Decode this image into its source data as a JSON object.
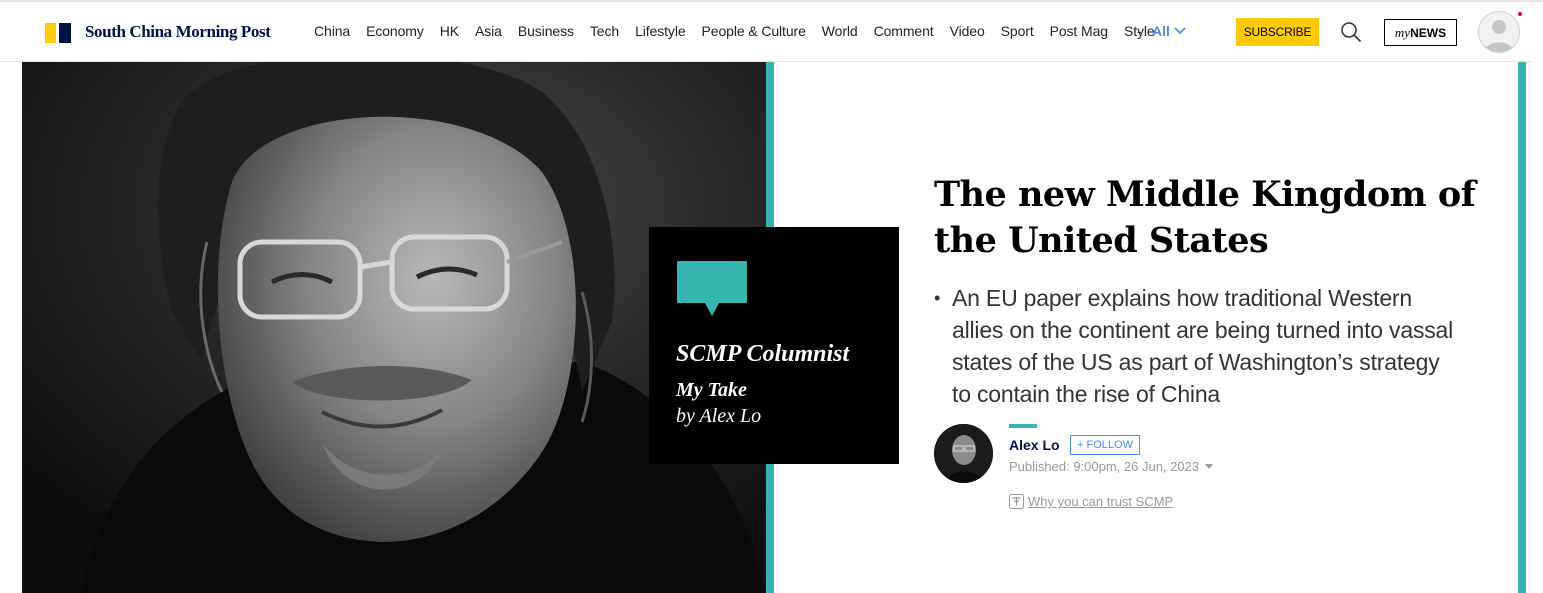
{
  "brand": {
    "name": "South China Morning Post",
    "colors": {
      "yellow": "#ffca05",
      "navy": "#001246",
      "teal": "#39b5b1",
      "link_blue": "#4a8af4"
    }
  },
  "nav": {
    "links": [
      "China",
      "Economy",
      "HK",
      "Asia",
      "Business",
      "Tech",
      "Lifestyle",
      "People & Culture",
      "World",
      "Comment",
      "Video",
      "Sport",
      "Post Mag",
      "Style"
    ],
    "separator": "-",
    "all_label": "All",
    "all_icon": "chevron-down-icon",
    "subscribe_label": "SUBSCRIBE",
    "search_icon": "search-icon",
    "mynews": {
      "prefix": "my",
      "suffix": "NEWS"
    }
  },
  "hero": {
    "badge": {
      "icon": "speech-bubble-icon",
      "title": "SCMP Columnist",
      "subtitle": "My Take",
      "byline": "by Alex Lo"
    }
  },
  "article": {
    "headline": "The new Middle Kingdom of the United States",
    "summary_bullet": "•",
    "summary": "An EU paper explains how traditional Western allies on the continent are being turned into vassal states of the US as part of Washington’s strategy to contain the rise of China",
    "author": {
      "name": "Alex Lo",
      "follow_label": "+ FOLLOW",
      "published": "Published: 9:00pm, 26 Jun, 2023"
    },
    "trust_link": "Why you can trust SCMP"
  }
}
